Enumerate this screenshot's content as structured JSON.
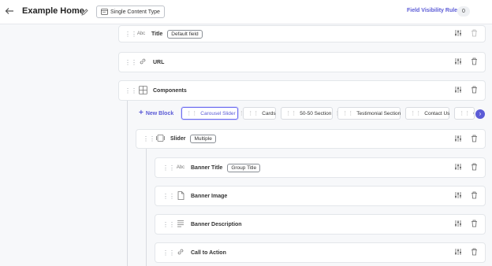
{
  "header": {
    "back_icon": "arrow-left-icon",
    "title": "Example Home",
    "edit_icon": "pencil-icon",
    "content_type_label": "Single Content Type",
    "field_visibility_label": "Field Visibility Rules",
    "field_visibility_count": "0"
  },
  "fields": [
    {
      "name": "Title",
      "icon": "Abc",
      "tag": "Default field"
    },
    {
      "name": "URL",
      "icon": "link-icon"
    },
    {
      "name": "Components",
      "icon": "grid-icon"
    }
  ],
  "blocks": {
    "new_block_label": "New Block",
    "chips": [
      "Carousel Slider",
      "Cards",
      "50-50 Section",
      "Testimonial Section",
      "Contact Us",
      "Co"
    ]
  },
  "slider": {
    "name": "Slider",
    "tag": "Multiple"
  },
  "slider_fields": [
    {
      "name": "Banner Title",
      "icon": "Abc",
      "tag": "Group Title"
    },
    {
      "name": "Banner Image",
      "icon": "file-icon"
    },
    {
      "name": "Banner Description",
      "icon": "text-lines-icon"
    },
    {
      "name": "Call to Action",
      "icon": "link-icon"
    }
  ]
}
